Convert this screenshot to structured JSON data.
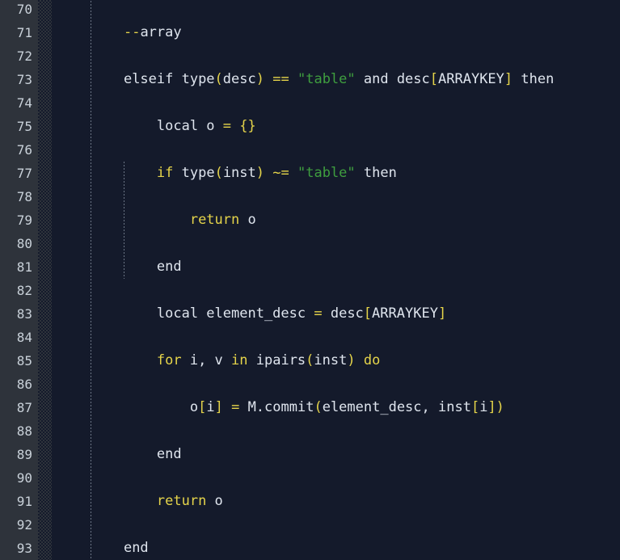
{
  "editor": {
    "language": "lua",
    "first_line_number": 70,
    "last_line_number": 93,
    "line_height_px": 29,
    "tab_size": 4,
    "colors": {
      "background": "#141a2b",
      "gutter_background": "#2e333b",
      "line_number": "#c9d1d9",
      "default_text": "#dfe5ee",
      "keyword": "#e5d44a",
      "operator": "#e5d44a",
      "string": "#3f9e3f",
      "indent_guide": "#6b7585"
    }
  },
  "line_numbers": [
    "70",
    "71",
    "72",
    "73",
    "74",
    "75",
    "76",
    "77",
    "78",
    "79",
    "80",
    "81",
    "82",
    "83",
    "84",
    "85",
    "86",
    "87",
    "88",
    "89",
    "90",
    "91",
    "92",
    "93"
  ],
  "lines": [
    {
      "number": "70",
      "text": ""
    },
    {
      "number": "71",
      "text": "    --array"
    },
    {
      "number": "72",
      "text": ""
    },
    {
      "number": "73",
      "text": "    elseif type(desc) == \"table\" and desc[ARRAYKEY] then"
    },
    {
      "number": "74",
      "text": ""
    },
    {
      "number": "75",
      "text": "        local o = {}"
    },
    {
      "number": "76",
      "text": ""
    },
    {
      "number": "77",
      "text": "        if type(inst) ~= \"table\" then"
    },
    {
      "number": "78",
      "text": ""
    },
    {
      "number": "79",
      "text": "            return o"
    },
    {
      "number": "80",
      "text": ""
    },
    {
      "number": "81",
      "text": "        end"
    },
    {
      "number": "82",
      "text": ""
    },
    {
      "number": "83",
      "text": "        local element_desc = desc[ARRAYKEY]"
    },
    {
      "number": "84",
      "text": ""
    },
    {
      "number": "85",
      "text": "        for i, v in ipairs(inst) do"
    },
    {
      "number": "86",
      "text": ""
    },
    {
      "number": "87",
      "text": "            o[i] = M.commit(element_desc, inst[i])"
    },
    {
      "number": "88",
      "text": ""
    },
    {
      "number": "89",
      "text": "        end"
    },
    {
      "number": "90",
      "text": ""
    },
    {
      "number": "91",
      "text": "        return o"
    },
    {
      "number": "92",
      "text": ""
    },
    {
      "number": "93",
      "text": "    end"
    }
  ],
  "tokens": [
    {
      "number": "70",
      "parts": []
    },
    {
      "number": "71",
      "parts": [
        {
          "t": "    ",
          "c": "plain"
        },
        {
          "t": "--",
          "c": "comment-dash"
        },
        {
          "t": "array",
          "c": "comment"
        }
      ]
    },
    {
      "number": "72",
      "parts": []
    },
    {
      "number": "73",
      "parts": [
        {
          "t": "    ",
          "c": "plain"
        },
        {
          "t": "elseif type",
          "c": "plain"
        },
        {
          "t": "(",
          "c": "op"
        },
        {
          "t": "desc",
          "c": "plain"
        },
        {
          "t": ")",
          "c": "op"
        },
        {
          "t": " ",
          "c": "plain"
        },
        {
          "t": "==",
          "c": "op"
        },
        {
          "t": " ",
          "c": "plain"
        },
        {
          "t": "\"table\"",
          "c": "string"
        },
        {
          "t": " and desc",
          "c": "plain"
        },
        {
          "t": "[",
          "c": "op"
        },
        {
          "t": "ARRAYKEY",
          "c": "plain"
        },
        {
          "t": "]",
          "c": "op"
        },
        {
          "t": " then",
          "c": "plain"
        }
      ]
    },
    {
      "number": "74",
      "parts": []
    },
    {
      "number": "75",
      "parts": [
        {
          "t": "        ",
          "c": "plain"
        },
        {
          "t": "local o ",
          "c": "plain"
        },
        {
          "t": "=",
          "c": "op"
        },
        {
          "t": " ",
          "c": "plain"
        },
        {
          "t": "{}",
          "c": "op"
        }
      ]
    },
    {
      "number": "76",
      "parts": []
    },
    {
      "number": "77",
      "parts": [
        {
          "t": "        ",
          "c": "plain"
        },
        {
          "t": "if",
          "c": "keyword"
        },
        {
          "t": " type",
          "c": "plain"
        },
        {
          "t": "(",
          "c": "op"
        },
        {
          "t": "inst",
          "c": "plain"
        },
        {
          "t": ")",
          "c": "op"
        },
        {
          "t": " ",
          "c": "plain"
        },
        {
          "t": "~=",
          "c": "op"
        },
        {
          "t": " ",
          "c": "plain"
        },
        {
          "t": "\"table\"",
          "c": "string"
        },
        {
          "t": " then",
          "c": "plain"
        }
      ]
    },
    {
      "number": "78",
      "parts": []
    },
    {
      "number": "79",
      "parts": [
        {
          "t": "            ",
          "c": "plain"
        },
        {
          "t": "return",
          "c": "keyword"
        },
        {
          "t": " o",
          "c": "plain"
        }
      ]
    },
    {
      "number": "80",
      "parts": []
    },
    {
      "number": "81",
      "parts": [
        {
          "t": "        ",
          "c": "plain"
        },
        {
          "t": "end",
          "c": "plain"
        }
      ]
    },
    {
      "number": "82",
      "parts": []
    },
    {
      "number": "83",
      "parts": [
        {
          "t": "        ",
          "c": "plain"
        },
        {
          "t": "local element_desc ",
          "c": "plain"
        },
        {
          "t": "=",
          "c": "op"
        },
        {
          "t": " desc",
          "c": "plain"
        },
        {
          "t": "[",
          "c": "op"
        },
        {
          "t": "ARRAYKEY",
          "c": "plain"
        },
        {
          "t": "]",
          "c": "op"
        }
      ]
    },
    {
      "number": "84",
      "parts": []
    },
    {
      "number": "85",
      "parts": [
        {
          "t": "        ",
          "c": "plain"
        },
        {
          "t": "for",
          "c": "keyword"
        },
        {
          "t": " i, v ",
          "c": "plain"
        },
        {
          "t": "in",
          "c": "keyword"
        },
        {
          "t": " ipairs",
          "c": "plain"
        },
        {
          "t": "(",
          "c": "op"
        },
        {
          "t": "inst",
          "c": "plain"
        },
        {
          "t": ")",
          "c": "op"
        },
        {
          "t": " ",
          "c": "plain"
        },
        {
          "t": "do",
          "c": "keyword"
        }
      ]
    },
    {
      "number": "86",
      "parts": []
    },
    {
      "number": "87",
      "parts": [
        {
          "t": "            ",
          "c": "plain"
        },
        {
          "t": "o",
          "c": "plain"
        },
        {
          "t": "[",
          "c": "op"
        },
        {
          "t": "i",
          "c": "plain"
        },
        {
          "t": "]",
          "c": "op"
        },
        {
          "t": " ",
          "c": "plain"
        },
        {
          "t": "=",
          "c": "op"
        },
        {
          "t": " M.commit",
          "c": "plain"
        },
        {
          "t": "(",
          "c": "op"
        },
        {
          "t": "element_desc, inst",
          "c": "plain"
        },
        {
          "t": "[",
          "c": "op"
        },
        {
          "t": "i",
          "c": "plain"
        },
        {
          "t": "])",
          "c": "op"
        }
      ]
    },
    {
      "number": "88",
      "parts": []
    },
    {
      "number": "89",
      "parts": [
        {
          "t": "        ",
          "c": "plain"
        },
        {
          "t": "end",
          "c": "plain"
        }
      ]
    },
    {
      "number": "90",
      "parts": []
    },
    {
      "number": "91",
      "parts": [
        {
          "t": "        ",
          "c": "plain"
        },
        {
          "t": "return",
          "c": "keyword"
        },
        {
          "t": " o",
          "c": "plain"
        }
      ]
    },
    {
      "number": "92",
      "parts": []
    },
    {
      "number": "93",
      "parts": [
        {
          "t": "    ",
          "c": "plain"
        },
        {
          "t": "end",
          "c": "plain"
        }
      ]
    }
  ],
  "indent_guides": [
    {
      "level": 1,
      "start_line": "70",
      "end_line": "93"
    },
    {
      "level": 2,
      "start_line": "77",
      "end_line": "81"
    }
  ]
}
